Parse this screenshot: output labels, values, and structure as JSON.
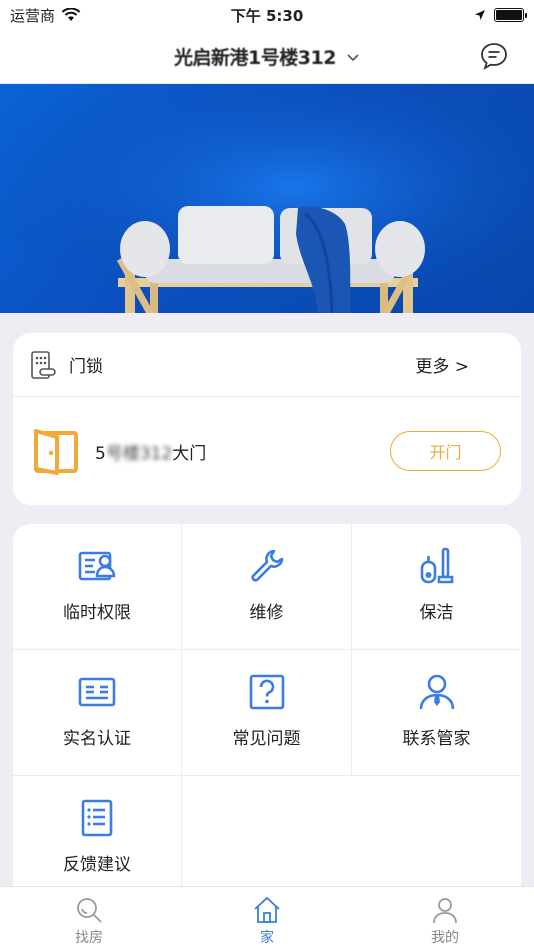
{
  "status_bar": {
    "carrier": "运营商",
    "time": "下午 5:30"
  },
  "nav": {
    "title": "光启新港1号楼312",
    "message_icon": "message-icon"
  },
  "lock": {
    "title": "门锁",
    "more": "更多 >",
    "door_prefix": "5",
    "door_hidden": "号楼312",
    "door_suffix": "大门",
    "open_label": "开门",
    "accent": "#f1a93a"
  },
  "services": [
    {
      "label": "临时权限",
      "icon": "temporary-permission-icon"
    },
    {
      "label": "维修",
      "icon": "wrench-icon"
    },
    {
      "label": "保洁",
      "icon": "cleaning-icon"
    },
    {
      "label": "实名认证",
      "icon": "id-card-icon"
    },
    {
      "label": "常见问题",
      "icon": "question-icon"
    },
    {
      "label": "联系管家",
      "icon": "butler-icon"
    },
    {
      "label": "反馈建议",
      "icon": "feedback-icon"
    }
  ],
  "tabs": [
    {
      "label": "找房",
      "icon": "search-icon",
      "active": false
    },
    {
      "label": "家",
      "icon": "home-icon",
      "active": true
    },
    {
      "label": "我的",
      "icon": "user-icon",
      "active": false
    }
  ],
  "colors": {
    "icon_blue": "#3b7de0",
    "tab_inactive": "#9a9a9a",
    "banner_blue": "#0b55c6"
  }
}
